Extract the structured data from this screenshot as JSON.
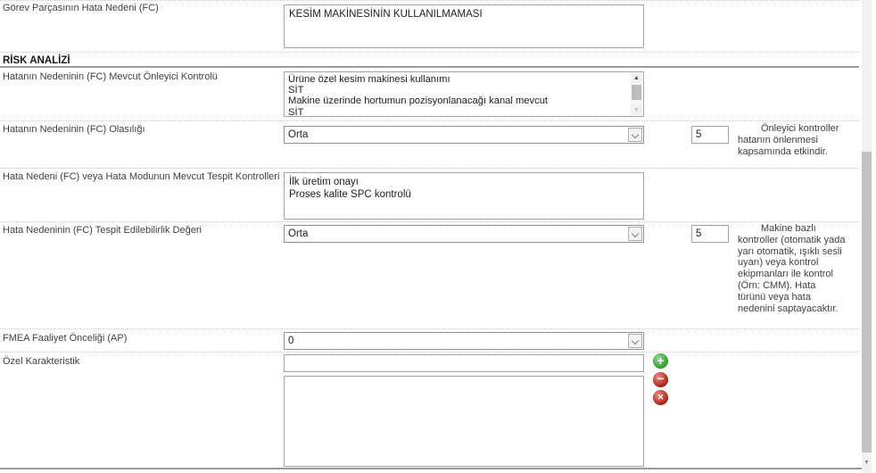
{
  "section_header": "RİSK ANALİZİ",
  "fields": {
    "gorev_hata_nedeni": {
      "label": "Görev Parçasının Hata Nedeni (FC)",
      "value": "KESİM MAKİNESİNİN KULLANILMAMASI"
    },
    "onleyici_kontrol": {
      "label": "Hatanın Nedeninin (FC) Mevcut Önleyici Kontrolü",
      "items": [
        "Ürüne özel kesim makinesi kullanımı",
        "SİT",
        "Makine üzerinde hortumun pozisyonlanacağı kanal mevcut",
        "SİT"
      ]
    },
    "olasilik": {
      "label": "Hatanın Nedeninin (FC) Olasılığı",
      "selected": "Orta",
      "score": "5",
      "note": "Önleyici kontroller hatanın önlenmesi kapsamında etkindir."
    },
    "tespit_kontrolleri": {
      "label": "Hata Nedeni (FC) veya Hata Modunun Mevcut Tespit Kontrolleri",
      "value": "İlk üretim onayı\nProses kalite SPC kontrolü"
    },
    "tespit_degeri": {
      "label": "Hata Nedeninin (FC) Tespit Edilebilirlik Değeri",
      "selected": "Orta",
      "score": "5",
      "note": "Makine bazlı kontroller (otomatik yada yarı otomatik, ışıklı sesli uyarı) veya kontrol ekipmanları ile kontrol (Örn: CMM). Hata türünü veya hata nedenini saptayacaktır."
    },
    "ap": {
      "label": "FMEA Faaliyet Önceliği (AP)",
      "selected": "0"
    },
    "ozel_karakteristik": {
      "label": "Özel Karakteristik",
      "value": ""
    }
  },
  "icons": {
    "add_glyph": "+",
    "remove_glyph": "−",
    "delete_glyph": "✕",
    "scroll_up_glyph": "▲",
    "scroll_down_glyph": "▼"
  },
  "colors": {
    "add_green": "#2f9e2f",
    "remove_red": "#b21f12",
    "delete_red": "#b21f12",
    "border_gray": "#a3a3a3"
  }
}
